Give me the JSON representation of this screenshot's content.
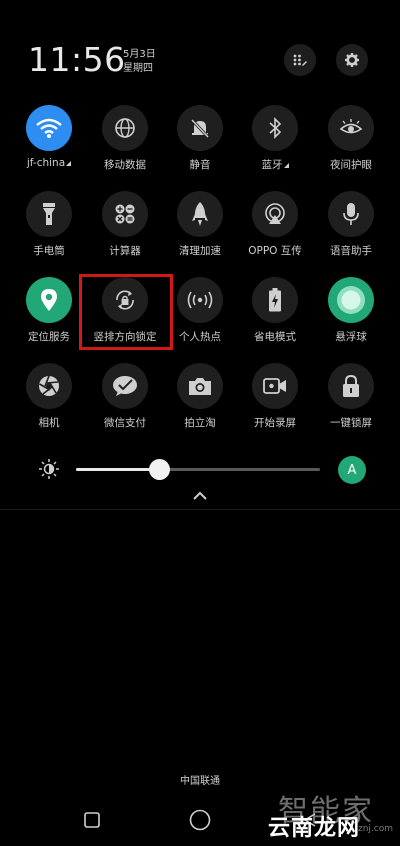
{
  "status": {
    "time": "11:56",
    "date": "5月3日",
    "weekday": "星期四"
  },
  "header_buttons": [
    "edit-icon",
    "gear-icon"
  ],
  "tiles": [
    {
      "label": "jf-china",
      "icon": "wifi-icon",
      "state": "on-blue"
    },
    {
      "label": "移动数据",
      "icon": "globe-icon",
      "state": "off"
    },
    {
      "label": "静音",
      "icon": "bell-mute-icon",
      "state": "off"
    },
    {
      "label": "蓝牙",
      "icon": "bluetooth-icon",
      "state": "off"
    },
    {
      "label": "夜间护眼",
      "icon": "eye-icon",
      "state": "off"
    },
    {
      "label": "手电筒",
      "icon": "flashlight-icon",
      "state": "off"
    },
    {
      "label": "计算器",
      "icon": "calculator-icon",
      "state": "off"
    },
    {
      "label": "清理加速",
      "icon": "rocket-icon",
      "state": "off"
    },
    {
      "label": "OPPO 互传",
      "icon": "share-icon",
      "state": "off"
    },
    {
      "label": "语音助手",
      "icon": "microphone-icon",
      "state": "off"
    },
    {
      "label": "定位服务",
      "icon": "location-icon",
      "state": "on"
    },
    {
      "label": "竖排方向锁定",
      "icon": "rotation-lock-icon",
      "state": "off"
    },
    {
      "label": "个人热点",
      "icon": "hotspot-icon",
      "state": "off"
    },
    {
      "label": "省电模式",
      "icon": "battery-icon",
      "state": "off"
    },
    {
      "label": "悬浮球",
      "icon": "floating-ball-icon",
      "state": "on"
    },
    {
      "label": "相机",
      "icon": "camera-aperture-icon",
      "state": "off"
    },
    {
      "label": "微信支付",
      "icon": "wechat-pay-icon",
      "state": "off"
    },
    {
      "label": "拍立淘",
      "icon": "camera-icon",
      "state": "off"
    },
    {
      "label": "开始录屏",
      "icon": "video-icon",
      "state": "off"
    },
    {
      "label": "一键锁屏",
      "icon": "padlock-icon",
      "state": "off"
    }
  ],
  "brightness": {
    "level": 0.34,
    "auto_label": "A"
  },
  "carrier": "中国联通",
  "watermark": {
    "text": "智能家",
    "sub": "云南龙网",
    "domain": "znj.com"
  },
  "colors": {
    "accent_green": "#22a877",
    "accent_blue": "#2e8df0",
    "highlight_red": "#d11818"
  }
}
